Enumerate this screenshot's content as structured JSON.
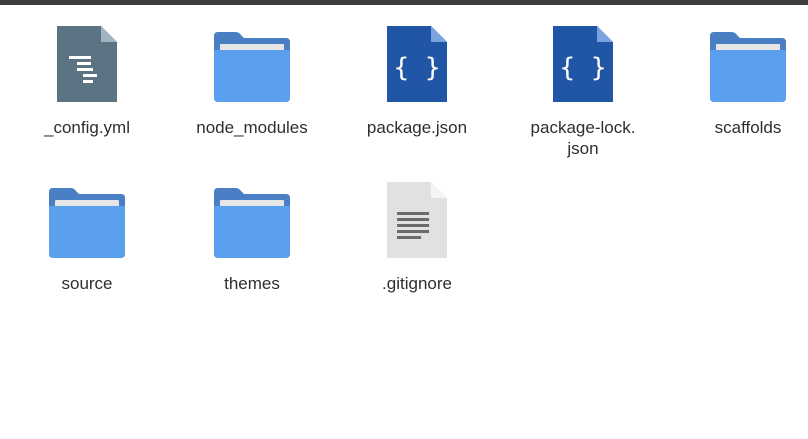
{
  "window": {
    "view": "icon-grid"
  },
  "files": [
    {
      "name": "_config.yml",
      "icon": "yaml-config-file-icon"
    },
    {
      "name": "node_modules",
      "icon": "folder-icon"
    },
    {
      "name": "package.json",
      "icon": "json-file-icon"
    },
    {
      "name": "package-lock.\njson",
      "icon": "json-file-icon"
    },
    {
      "name": "scaffolds",
      "icon": "folder-icon"
    },
    {
      "name": "source",
      "icon": "folder-icon"
    },
    {
      "name": "themes",
      "icon": "folder-icon"
    },
    {
      "name": ".gitignore",
      "icon": "text-file-icon"
    }
  ],
  "colors": {
    "folder_tab": "#4a7fc6",
    "folder_body": "#5aa0ee",
    "folder_paper": "#e6e6e6",
    "json_file": "#2155a6",
    "yaml_file": "#5b7382",
    "text_file": "#e1e1e1"
  }
}
